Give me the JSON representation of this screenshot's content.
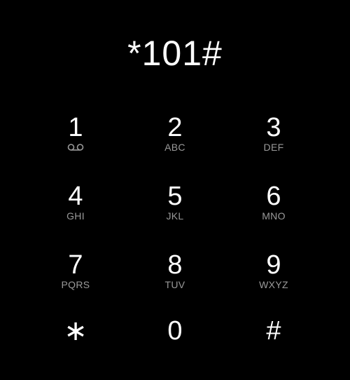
{
  "display": {
    "number": "*101#"
  },
  "keypad": {
    "keys": [
      {
        "digit": "1",
        "letters": "",
        "icon": "voicemail-icon"
      },
      {
        "digit": "2",
        "letters": "ABC"
      },
      {
        "digit": "3",
        "letters": "DEF"
      },
      {
        "digit": "4",
        "letters": "GHI"
      },
      {
        "digit": "5",
        "letters": "JKL"
      },
      {
        "digit": "6",
        "letters": "MNO"
      },
      {
        "digit": "7",
        "letters": "PQRS"
      },
      {
        "digit": "8",
        "letters": "TUV"
      },
      {
        "digit": "9",
        "letters": "WXYZ"
      },
      {
        "digit": "∗",
        "letters": ""
      },
      {
        "digit": "0",
        "letters": ""
      },
      {
        "digit": "#",
        "letters": ""
      }
    ]
  },
  "colors": {
    "background": "#000000",
    "digit": "#ffffff",
    "letters": "#9a9a9a"
  }
}
